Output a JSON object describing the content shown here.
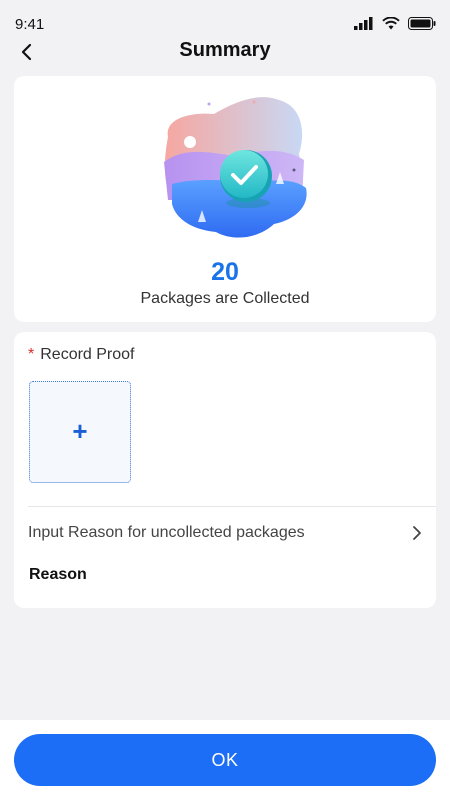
{
  "status_bar": {
    "time": "9:41"
  },
  "header": {
    "title": "Summary",
    "back_icon": "chevron-left-icon"
  },
  "summary": {
    "count": "20",
    "label": "Packages are Collected"
  },
  "proof": {
    "required_mark": "*",
    "title": "Record Proof",
    "upload_symbol": "+",
    "reason_prompt": "Input Reason for uncollected packages",
    "reason_label": "Reason"
  },
  "footer": {
    "ok_label": "OK"
  },
  "colors": {
    "accent": "#1b6ef5",
    "count": "#1a73e8",
    "required": "#e02b2b"
  }
}
